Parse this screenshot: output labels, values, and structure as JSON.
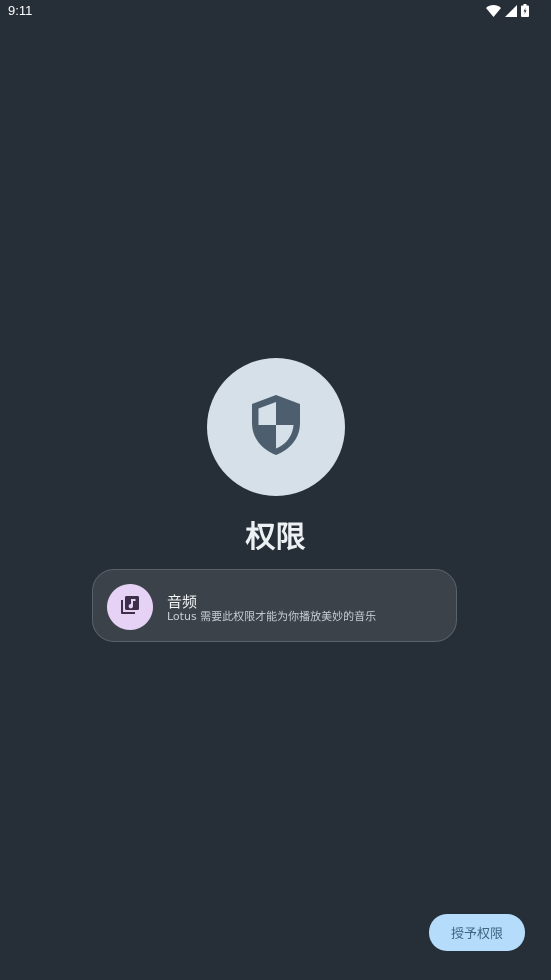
{
  "status_bar": {
    "time": "9:11",
    "icons": [
      "wifi-icon",
      "signal-icon",
      "battery-icon"
    ]
  },
  "main": {
    "icon": "shield-icon",
    "title": "权限"
  },
  "permission": {
    "icon": "music-library-icon",
    "name": "音频",
    "description": "Lotus 需要此权限才能为你播放美妙的音乐"
  },
  "actions": {
    "grant_label": "授予权限"
  },
  "colors": {
    "background": "#262f38",
    "shield_circle": "#d5e0e9",
    "shield": "#4d5f6e",
    "card": "#3b4249",
    "permission_icon_bg": "#e6d2f5",
    "grant_button": "#b6dcfb"
  }
}
